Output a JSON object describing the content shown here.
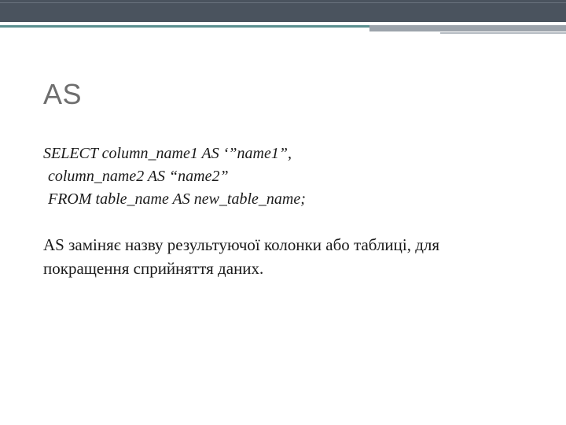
{
  "slide": {
    "title": "AS",
    "code": {
      "line1": "SELECT column_name1 AS ‘”name1”,",
      "line2": "column_name2 AS “name2”",
      "line3": "FROM table_name AS new_table_name;"
    },
    "description": "AS заміняє назву результуючої колонки або таблиці, для покращення сприйняття даних."
  }
}
